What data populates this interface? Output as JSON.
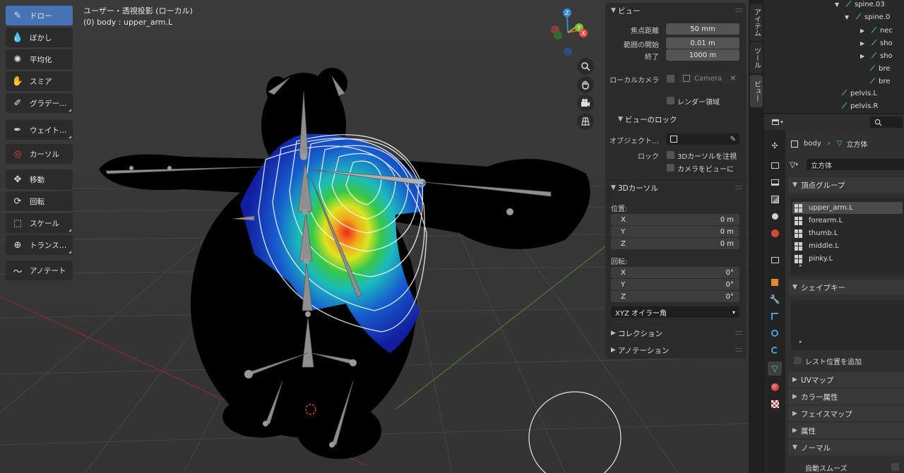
{
  "viewport": {
    "title": "ユーザー・透視投影 (ローカル)",
    "subtitle": "(0) body : upper_arm.L"
  },
  "toolbar": [
    {
      "label": "ドロー",
      "icon": "brush-draw-icon",
      "active": true
    },
    {
      "label": "ぼかし",
      "icon": "brush-blur-icon"
    },
    {
      "label": "平均化",
      "icon": "brush-average-icon"
    },
    {
      "label": "スミア",
      "icon": "brush-smear-icon"
    },
    {
      "label": "グラデー…",
      "icon": "gradient-icon"
    },
    {
      "label": "ウェイト…",
      "icon": "weight-sample-icon"
    },
    {
      "label": "カーソル",
      "icon": "cursor-icon"
    },
    {
      "label": "移動",
      "icon": "move-icon"
    },
    {
      "label": "回転",
      "icon": "rotate-icon"
    },
    {
      "label": "スケール",
      "icon": "scale-icon"
    },
    {
      "label": "トランス…",
      "icon": "transform-icon"
    },
    {
      "label": "アノテート",
      "icon": "annotate-icon"
    }
  ],
  "gizmo": {
    "z": "Z",
    "y": "Y",
    "x": "X"
  },
  "ntabs": [
    "アイテム",
    "ツール",
    "ビュー"
  ],
  "view_panel": {
    "header": "ビュー",
    "focal_label": "焦点距離",
    "focal_value": "50 mm",
    "clip_start_label": "範囲の開始",
    "clip_start_value": "0.01 m",
    "clip_end_label": "終了",
    "clip_end_value": "1000 m",
    "local_camera_label": "ローカルカメラ",
    "camera_value": "Camera",
    "render_region_label": "レンダー領域",
    "lock_header": "ビューのロック",
    "object_label": "オブジェクト…",
    "lock_label": "ロック",
    "lock_cursor_label": "3Dカーソルを注視",
    "camera_to_view_label": "カメラをビューに"
  },
  "cursor_panel": {
    "header": "3Dカーソル",
    "location_label": "位置:",
    "x_label": "X",
    "y_label": "Y",
    "z_label": "Z",
    "x_value": "0 m",
    "y_value": "0 m",
    "z_value": "0 m",
    "rotation_label": "回転:",
    "rx_value": "0°",
    "ry_value": "0°",
    "rz_value": "0°",
    "rotation_mode": "XYZ オイラー角"
  },
  "collections_header": "コレクション",
  "annotations_header": "アノテーション",
  "outliner": [
    {
      "label": "spine.03",
      "indent": 1,
      "tri": "▼"
    },
    {
      "label": "spine.0",
      "indent": 2,
      "tri": "▼"
    },
    {
      "label": "nec",
      "indent": 3,
      "tri": "▶"
    },
    {
      "label": "sho",
      "indent": 3,
      "tri": "▶"
    },
    {
      "label": "sho",
      "indent": 3,
      "tri": "▶"
    },
    {
      "label": "bre",
      "indent": 3,
      "tri": ""
    },
    {
      "label": "bre",
      "indent": 3,
      "tri": ""
    },
    {
      "label": "pelvis.L",
      "indent": 0,
      "tri": ""
    },
    {
      "label": "pelvis.R",
      "indent": 0,
      "tri": ""
    }
  ],
  "properties": {
    "breadcrumb_object": "body",
    "breadcrumb_sep": "›",
    "breadcrumb_data": "立方体",
    "data_name": "立方体",
    "vertex_groups_header": "頂点グループ",
    "vertex_groups": [
      "upper_arm.L",
      "forearm.L",
      "thumb.L",
      "middle.L",
      "pinky.L"
    ],
    "shape_keys_header": "シェイプキー",
    "add_rest_label": "レスト位置を追加",
    "uv_maps_header": "UVマップ",
    "color_attrs_header": "カラー属性",
    "face_maps_header": "フェイスマップ",
    "attributes_header": "属性",
    "normals_header": "ノーマル",
    "auto_smooth_label": "自動スムーズ"
  },
  "colors": {
    "accent": "#4772b3",
    "bone_green": "#3ecf8e",
    "gizmo_x": "#e5484d",
    "gizmo_y": "#7bbf2e",
    "gizmo_z": "#2f8bdb"
  }
}
